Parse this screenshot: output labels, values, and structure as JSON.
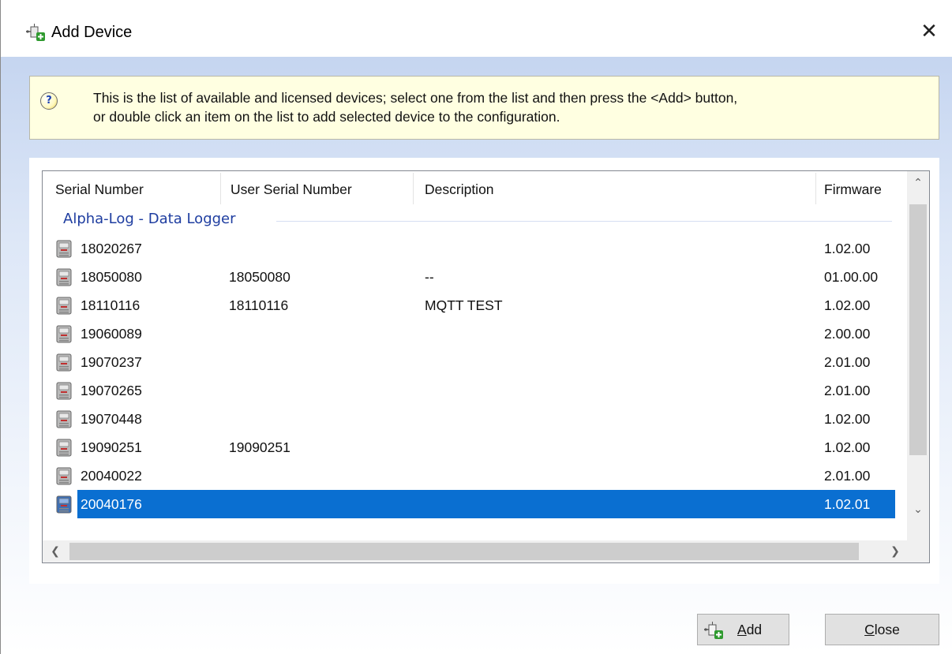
{
  "window": {
    "title": "Add Device",
    "close_symbol": "✕"
  },
  "info": {
    "line1": "This is the list of available and licensed devices; select one from the list and then press the <Add> button,",
    "line2": "or double click an item on the list to add selected device to the configuration.",
    "icon": "help-icon"
  },
  "list": {
    "columns": [
      "Serial Number",
      "User Serial Number",
      "Description",
      "Firmware"
    ],
    "group": "Alpha-Log - Data Logger",
    "rows": [
      {
        "serial": "18020267",
        "user_serial": "",
        "description": "",
        "firmware": "1.02.00"
      },
      {
        "serial": "18050080",
        "user_serial": "18050080",
        "description": "--",
        "firmware": "01.00.00"
      },
      {
        "serial": "18110116",
        "user_serial": "18110116",
        "description": "MQTT TEST",
        "firmware": "1.02.00"
      },
      {
        "serial": "19060089",
        "user_serial": "",
        "description": "",
        "firmware": "2.00.00"
      },
      {
        "serial": "19070237",
        "user_serial": "",
        "description": "",
        "firmware": "2.01.00"
      },
      {
        "serial": "19070265",
        "user_serial": "",
        "description": "",
        "firmware": "2.01.00"
      },
      {
        "serial": "19070448",
        "user_serial": "",
        "description": "",
        "firmware": "1.02.00"
      },
      {
        "serial": "19090251",
        "user_serial": "19090251",
        "description": "",
        "firmware": "1.02.00"
      },
      {
        "serial": "20040022",
        "user_serial": "",
        "description": "",
        "firmware": "2.01.00"
      },
      {
        "serial": "20040176",
        "user_serial": "",
        "description": "",
        "firmware": "1.02.01",
        "selected": true
      }
    ],
    "selection_color": "#0a6fd1"
  },
  "buttons": {
    "add": {
      "prefix": "",
      "hotkey": "A",
      "rest": "dd"
    },
    "close": {
      "hotkey": "C",
      "rest": "lose"
    }
  }
}
